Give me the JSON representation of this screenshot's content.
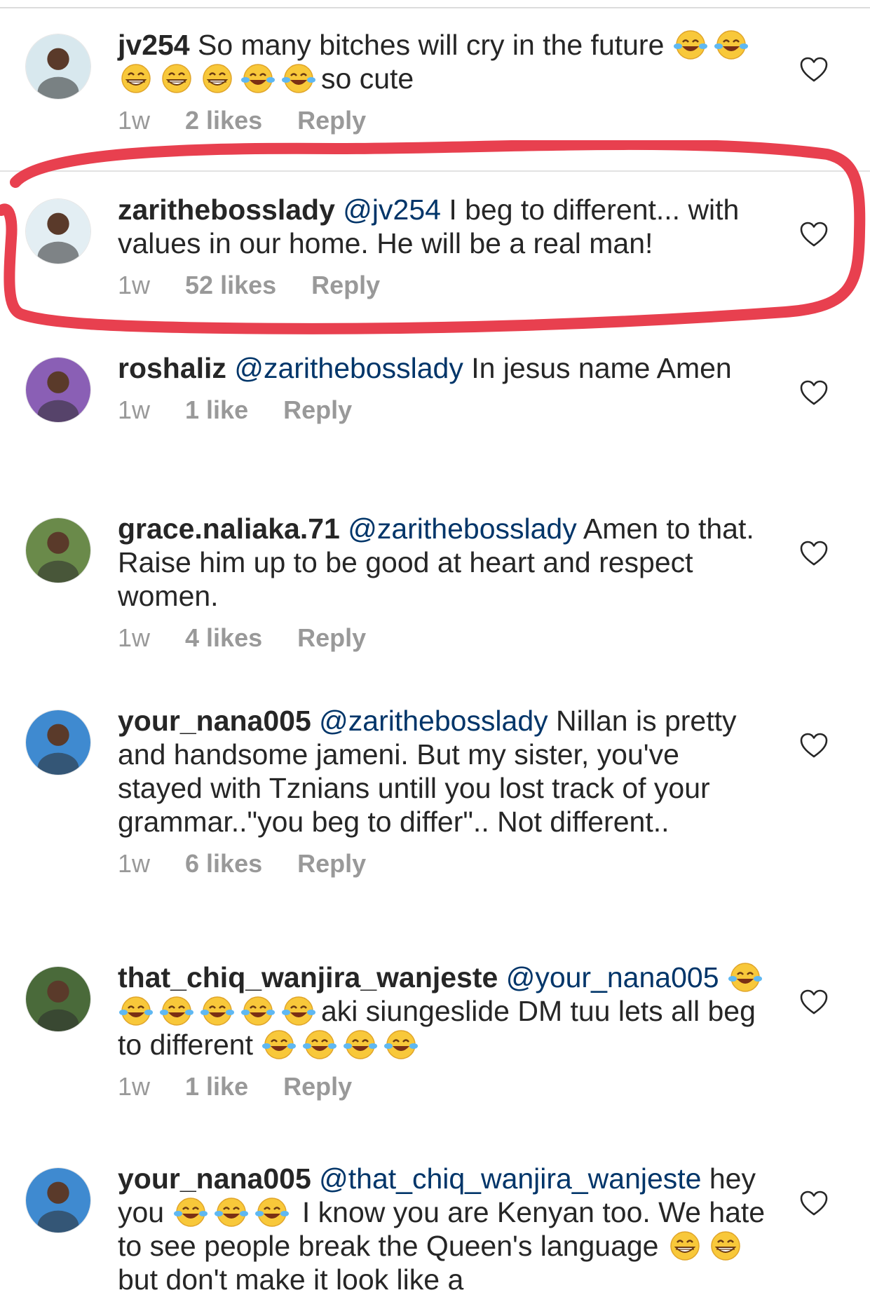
{
  "comments": [
    {
      "username": "jv254",
      "parts": [
        {
          "t": "text",
          "v": " So many bitches will cry in the future "
        },
        {
          "t": "emoji",
          "v": "rofl"
        },
        {
          "t": "emoji",
          "v": "joy"
        },
        {
          "t": "emoji",
          "v": "grin"
        },
        {
          "t": "emoji",
          "v": "grin"
        },
        {
          "t": "emoji",
          "v": "grin"
        },
        {
          "t": "emoji",
          "v": "joy"
        },
        {
          "t": "emoji",
          "v": "joy"
        },
        {
          "t": "text",
          "v": "so cute"
        }
      ],
      "time": "1w",
      "likes": "2 likes",
      "reply": "Reply"
    },
    {
      "username": "zarithebosslady",
      "parts": [
        {
          "t": "mention",
          "v": " @jv254"
        },
        {
          "t": "text",
          "v": " I beg to different... with values in our home. He will be a real man!"
        }
      ],
      "time": "1w",
      "likes": "52 likes",
      "reply": "Reply"
    },
    {
      "username": "roshaliz",
      "parts": [
        {
          "t": "mention",
          "v": " @zarithebosslady"
        },
        {
          "t": "text",
          "v": " In jesus name Amen"
        }
      ],
      "time": "1w",
      "likes": "1 like",
      "reply": "Reply"
    },
    {
      "username": "grace.naliaka.71",
      "parts": [
        {
          "t": "mention",
          "v": " @zarithebosslady"
        },
        {
          "t": "text",
          "v": " Amen to that. Raise him up to be good at heart and respect women."
        }
      ],
      "time": "1w",
      "likes": "4 likes",
      "reply": "Reply"
    },
    {
      "username": "your_nana005",
      "parts": [
        {
          "t": "mention",
          "v": " @zarithebosslady"
        },
        {
          "t": "text",
          "v": " Nillan is pretty and handsome jameni. But my sister, you've stayed with Tznians untill you lost track of your grammar..\"you beg to differ\".. Not different.."
        }
      ],
      "time": "1w",
      "likes": "6 likes",
      "reply": "Reply"
    },
    {
      "username": "that_chiq_wanjira_wanjeste",
      "parts": [
        {
          "t": "mention",
          "v": " @your_nana005"
        },
        {
          "t": "text",
          "v": " "
        },
        {
          "t": "emoji",
          "v": "joy"
        },
        {
          "t": "emoji",
          "v": "joy"
        },
        {
          "t": "emoji",
          "v": "joy"
        },
        {
          "t": "emoji",
          "v": "joy"
        },
        {
          "t": "emoji",
          "v": "joy"
        },
        {
          "t": "emoji",
          "v": "joy"
        },
        {
          "t": "text",
          "v": "aki siungeslide DM tuu lets all beg to different "
        },
        {
          "t": "emoji",
          "v": "joy"
        },
        {
          "t": "emoji",
          "v": "joy"
        },
        {
          "t": "emoji",
          "v": "joy"
        },
        {
          "t": "emoji",
          "v": "joy"
        }
      ],
      "time": "1w",
      "likes": "1 like",
      "reply": "Reply"
    },
    {
      "username": "your_nana005",
      "parts": [
        {
          "t": "mention",
          "v": " @that_chiq_wanjira_wanjeste"
        },
        {
          "t": "text",
          "v": " hey you "
        },
        {
          "t": "emoji",
          "v": "joy"
        },
        {
          "t": "emoji",
          "v": "joy"
        },
        {
          "t": "emoji",
          "v": "joy"
        },
        {
          "t": "text",
          "v": " I know you are Kenyan too. We hate to see people break the Queen's language "
        },
        {
          "t": "emoji",
          "v": "grin"
        },
        {
          "t": "emoji",
          "v": "grin"
        },
        {
          "t": "text",
          "v": "but don't make it look like a"
        }
      ],
      "time": "",
      "likes": "",
      "reply": ""
    }
  ],
  "icons": {
    "like": "heart-outline-icon",
    "highlight": "red-hand-drawn-circle"
  },
  "colors": {
    "text": "#262626",
    "mention": "#003569",
    "meta": "#999999",
    "highlight": "#e8404f"
  }
}
